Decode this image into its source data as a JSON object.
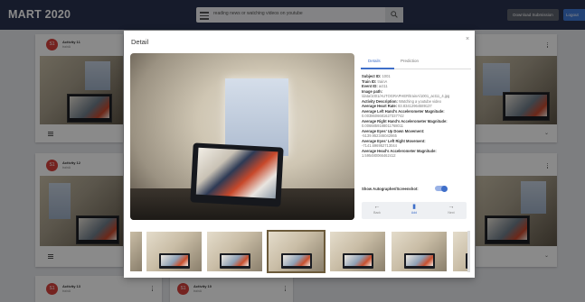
{
  "app": {
    "title": "MART 2020"
  },
  "search": {
    "placeholder": "reading news or watching videos on youtube"
  },
  "header": {
    "download_label": "Download Submission",
    "logout_label": "Logout"
  },
  "cards": [
    {
      "avatar": "S1",
      "title": "Activity 11",
      "subtitle": "trainA"
    },
    {
      "avatar": "S1",
      "title": "Activity 12",
      "subtitle": "trainA"
    },
    {
      "avatar": "S1",
      "title": "Activity 13",
      "subtitle": "trainA"
    },
    {
      "avatar": "S1",
      "title": "Activity 10",
      "subtitle": "trainA"
    }
  ],
  "modal": {
    "title": "Detail",
    "close_label": "×",
    "tabs": [
      "Details",
      "Prediction"
    ],
    "details": [
      {
        "label": "Subject ID:",
        "value": "1001"
      },
      {
        "label": "Train ID:",
        "value": "trainA"
      },
      {
        "label": "Event ID:",
        "value": "act11"
      },
      {
        "label": "Image path:",
        "value": "/data/1001/AUTOGRAPHER/trainA/1001_act11_4.jpg"
      },
      {
        "label": "Activity Description:",
        "value": "Watching a youtube video"
      },
      {
        "label": "Average Heart Rate:",
        "value": "83.83412964589137"
      },
      {
        "label": "Average Left Hand's Accelerometer Magnitude:",
        "value": "0.0038606681627337742"
      },
      {
        "label": "Average Right Hand's Accelerometer Magnitude:",
        "value": "0.0066859188011768011"
      },
      {
        "label": "Average Eyes' Up Down Movement:",
        "value": "-5139.952346042865"
      },
      {
        "label": "Average Eyes' Left Right Movement:",
        "value": "-7141.696952713044"
      },
      {
        "label": "Average Head's Accelerometer Magnitude:",
        "value": "1.595480066462412"
      }
    ],
    "toggle_label": "Show Autographer/Screenshot:",
    "toggle_on": true,
    "nav": {
      "back": "Back",
      "add": "Add",
      "next": "Next"
    }
  }
}
